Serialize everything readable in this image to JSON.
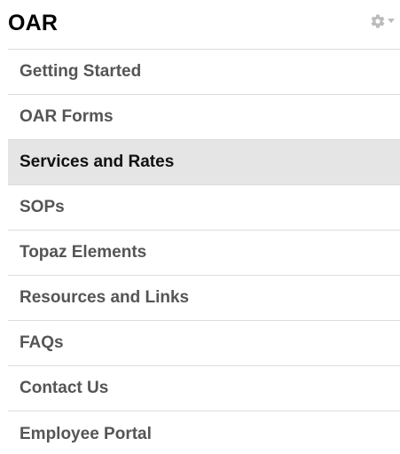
{
  "header": {
    "title": "OAR",
    "settings_icon": "gear-icon",
    "dropdown_icon": "caret-down-icon"
  },
  "nav": {
    "active_index": 2,
    "items": [
      {
        "label": "Getting Started"
      },
      {
        "label": "OAR Forms"
      },
      {
        "label": "Services and Rates"
      },
      {
        "label": "SOPs"
      },
      {
        "label": "Topaz Elements"
      },
      {
        "label": "Resources and Links"
      },
      {
        "label": "FAQs"
      },
      {
        "label": "Contact Us"
      },
      {
        "label": "Employee Portal"
      }
    ]
  },
  "colors": {
    "active_background": "#e5e5e5",
    "divider": "#dddddd",
    "text": "#555555",
    "active_text": "#111111",
    "icon": "#bbbbbb"
  }
}
